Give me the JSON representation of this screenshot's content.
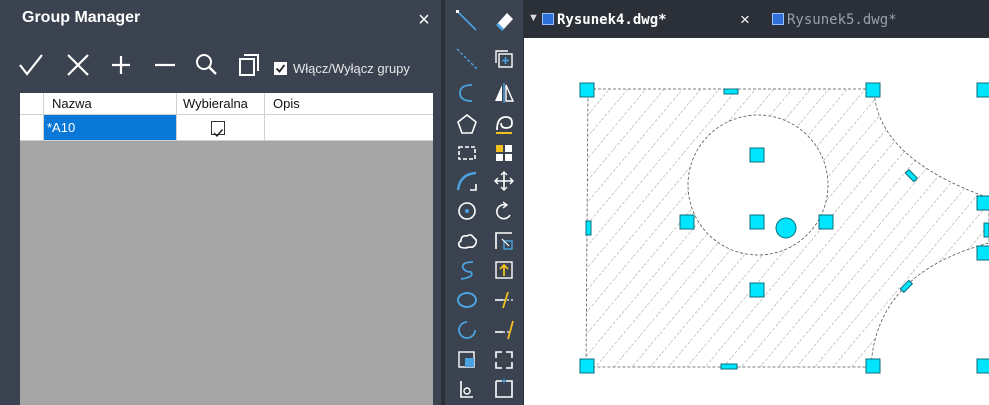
{
  "panel": {
    "title": "Group Manager",
    "close_label": "×",
    "toggle_label": "Włącz/Wyłącz grupy",
    "toggle_checked": true
  },
  "toolbar": {
    "buttons": [
      "check-icon",
      "x-icon",
      "plus-icon",
      "minus-icon",
      "search-icon",
      "copy-icon"
    ]
  },
  "grid": {
    "columns": [
      "Nazwa",
      "Wybieralna",
      "Opis"
    ],
    "rows": [
      {
        "name": "*A10",
        "selectable": true,
        "description": ""
      }
    ]
  },
  "tabs": [
    {
      "label": "Rysunek4.dwg*",
      "active": true,
      "close_label": "×"
    },
    {
      "label": "Rysunek5.dwg*",
      "active": false
    }
  ],
  "colors": {
    "grip": "#00e5ff",
    "selection": "#0a78d7",
    "panel": "#3b4250",
    "accent": "#4aa3df"
  },
  "tools_left": [
    "line-icon",
    "construction-line-icon",
    "polyline-icon",
    "polygon-icon",
    "rectangle-icon",
    "arc-icon",
    "circle-icon",
    "revision-cloud-icon",
    "spline-icon",
    "ellipse-icon",
    "ellipse-arc-icon",
    "insert-block-icon",
    "make-block-icon"
  ],
  "tools_right": [
    "erase-icon",
    "copy-object-icon",
    "mirror-icon",
    "offset-icon",
    "array-icon",
    "move-icon",
    "rotate-icon",
    "scale-icon",
    "stretch-icon",
    "trim-icon",
    "extend-icon",
    "break-icon",
    "join-icon"
  ]
}
